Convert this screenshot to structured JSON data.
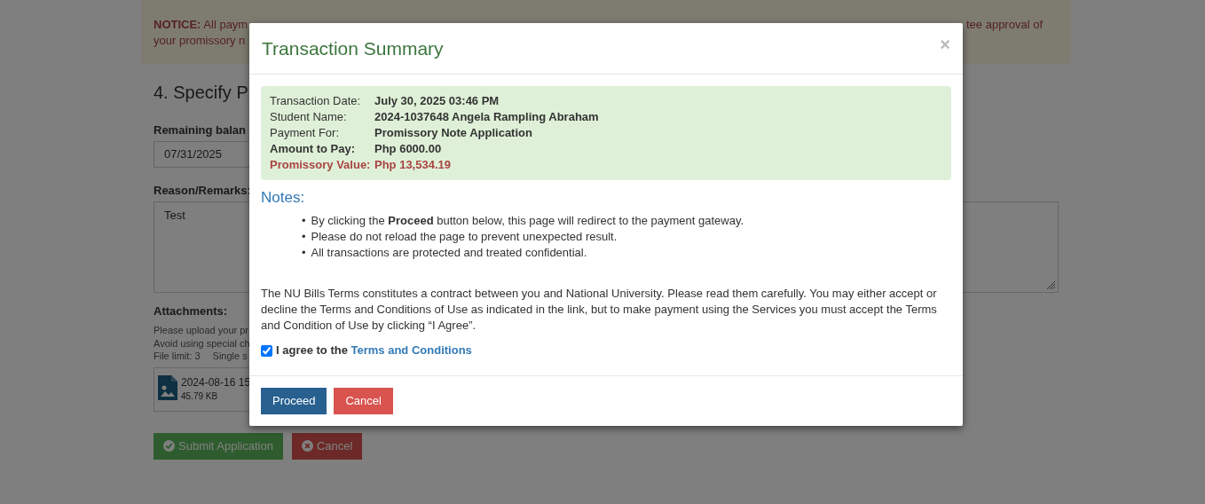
{
  "notice": {
    "lead": "NOTICE:",
    "line_1_start": "All paym",
    "line_1_end": "tee approval of",
    "line_2_start": "your promissory n"
  },
  "section_title": "4. Specify P",
  "fields": [
    {
      "kind": "input",
      "label": "Remaining balan",
      "value": "07/31/2025"
    },
    {
      "kind": "textarea",
      "label": "Reason/Remarks:",
      "value": "Test"
    }
  ],
  "attachments": {
    "label": "Attachments:",
    "hints": [
      "Please upload your pr",
      "Avoid using special ch"
    ],
    "file_limit": "File limit: 3",
    "size_limit": "Single s",
    "files": [
      {
        "name": "2024-08-16 15",
        "size": "45.79 KB"
      }
    ]
  },
  "actions": [
    {
      "kind": "success",
      "label": "Submit Application"
    },
    {
      "kind": "danger",
      "label": "Cancel"
    }
  ],
  "modal": {
    "title": "Transaction Summary",
    "close": "×",
    "summary": [
      {
        "kind": "plain",
        "label": "Transaction Date:",
        "value": "July 30, 2025 03:46 PM"
      },
      {
        "kind": "plain",
        "label": "Student Name:",
        "value": "2024-1037648 Angela Rampling Abraham"
      },
      {
        "kind": "plain",
        "label": "Payment For:",
        "value": "Promissory Note Application"
      },
      {
        "kind": "bold",
        "label": "Amount to Pay:",
        "value": "Php 6000.00"
      },
      {
        "kind": "danger",
        "label": "Promissory Value:",
        "value": "Php 13,534.19"
      }
    ],
    "notes_title": "Notes:",
    "notes": [
      {
        "bullet": "•",
        "text": "By clicking the **Proceed** button below, this page will redirect to the payment gateway."
      },
      {
        "bullet": "•",
        "text": "Please do not reload the page to prevent unexpected result."
      },
      {
        "bullet": "•",
        "text": "All transactions are protected and treated confidential."
      }
    ],
    "terms_text": "The NU Bills Terms constitutes a contract between you and National University. Please read them carefully. You may either accept or decline the Terms and Conditions of Use as indicated in the link, but to make payment using the Services you must accept the Terms and Condition of Use by clicking “I Agree”.",
    "agree": {
      "checked": true,
      "label": "I agree to the",
      "link": "Terms and Conditions"
    },
    "buttons": [
      {
        "kind": "primary",
        "label": "Proceed"
      },
      {
        "kind": "danger",
        "label": "Cancel"
      }
    ]
  }
}
